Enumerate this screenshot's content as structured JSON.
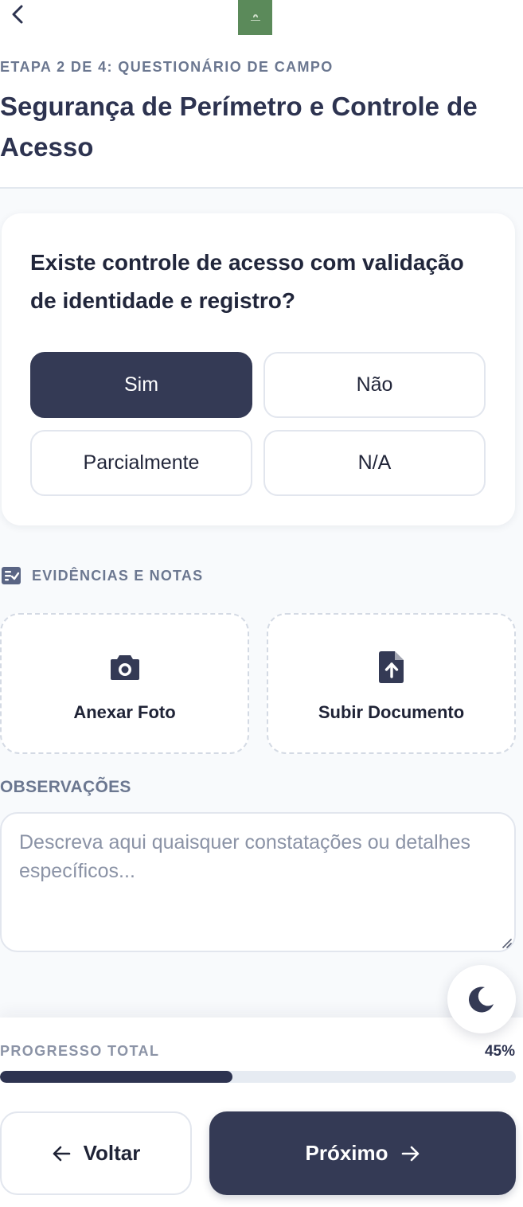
{
  "header": {
    "back_icon": "chevron-left-icon",
    "logo_icon": "leaf-logo-icon",
    "step_label": "ETAPA 2 DE 4: QUESTIONÁRIO DE CAMPO",
    "title": "Segurança de Perímetro e Controle de Acesso"
  },
  "question": {
    "text": "Existe controle de acesso com validação de identidade e registro?",
    "options": [
      {
        "label": "Sim",
        "selected": true
      },
      {
        "label": "Não",
        "selected": false
      },
      {
        "label": "Parcialmente",
        "selected": false
      },
      {
        "label": "N/A",
        "selected": false
      }
    ]
  },
  "evidence": {
    "icon": "checklist-icon",
    "title": "EVIDÊNCIAS E NOTAS",
    "photo": {
      "icon": "camera-icon",
      "label": "Anexar Foto"
    },
    "document": {
      "icon": "file-upload-icon",
      "label": "Subir Documento"
    }
  },
  "observations": {
    "label": "OBSERVAÇÕES",
    "value": "",
    "placeholder": "Descreva aqui quaisquer constatações ou detalhes específicos..."
  },
  "theme_toggle": {
    "icon": "moon-icon"
  },
  "footer": {
    "progress_label": "PROGRESSO TOTAL",
    "progress_text": "45%",
    "progress_fraction": 0.45,
    "back_label": "Voltar",
    "back_icon": "arrow-left-icon",
    "next_label": "Próximo",
    "next_icon": "arrow-right-icon"
  },
  "colors": {
    "primary": "#343a55",
    "text_dark": "#2d3350",
    "text_muted": "#6b7790",
    "border": "#e2e6ee",
    "background": "#f8fafc",
    "logo": "#5b8a5a"
  }
}
